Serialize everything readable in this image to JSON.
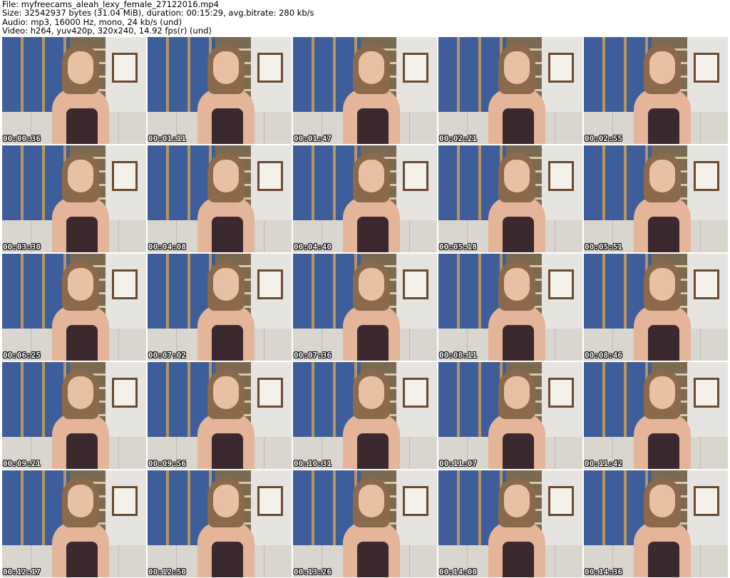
{
  "info": {
    "file": "File: myfreecams_aleah_lexy_female_27122016.mp4",
    "size": "Size: 32542937 bytes (31.04 MiB), duration: 00:15:29, avg.bitrate: 280 kb/s",
    "audio": "Audio: mp3, 16000 Hz, mono, 24 kb/s (und)",
    "video": "Video: h264, yuv420p, 320x240, 14.92 fps(r) (und)"
  },
  "thumbnails": [
    "00:00:36",
    "00:01:11",
    "00:01:47",
    "00:02:21",
    "00:02:55",
    "00:03:30",
    "00:04:08",
    "00:04:40",
    "00:05:18",
    "00:05:51",
    "00:06:25",
    "00:07:02",
    "00:07:36",
    "00:08:11",
    "00:08:46",
    "00:09:21",
    "00:09:56",
    "00:10:31",
    "00:11:07",
    "00:11:42",
    "00:12:17",
    "00:12:50",
    "00:13:26",
    "00:14:00",
    "00:14:36"
  ]
}
